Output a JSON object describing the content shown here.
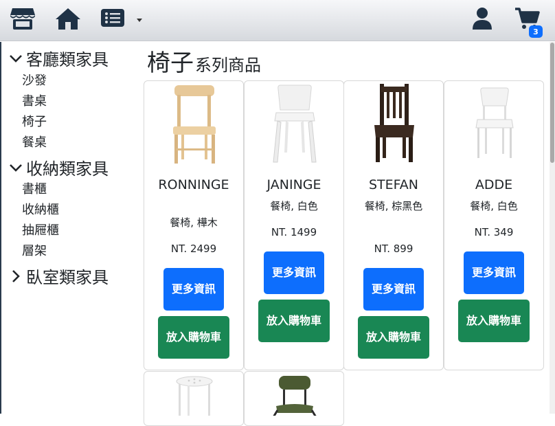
{
  "topbar": {
    "icons": [
      "store-icon",
      "home-icon",
      "list-icon",
      "user-icon",
      "cart-icon"
    ],
    "cart_count": "3",
    "bg_gradient": [
      "#f6f7f9",
      "#d6d9de"
    ]
  },
  "sidebar": {
    "categories": [
      {
        "label": "客廳類家具",
        "expanded": true,
        "items": [
          "沙發",
          "書桌",
          "椅子",
          "餐桌"
        ]
      },
      {
        "label": "收納類家具",
        "expanded": true,
        "items": [
          "書櫃",
          "收納櫃",
          "抽屜櫃",
          "層架"
        ]
      },
      {
        "label": "臥室類家具",
        "expanded": false,
        "items": []
      }
    ]
  },
  "main": {
    "title_big": "椅子",
    "title_small": "系列商品",
    "more_label": "更多資訊",
    "cart_label": "放入購物車",
    "products": [
      {
        "name": "RONNINGE",
        "desc": "餐椅, 樺木",
        "price": "NT. 2499"
      },
      {
        "name": "JANINGE",
        "desc": "餐椅, 白色",
        "price": "NT. 1499"
      },
      {
        "name": "STEFAN",
        "desc": "餐椅, 棕黑色",
        "price": "NT. 899"
      },
      {
        "name": "ADDE",
        "desc": "餐椅, 白色",
        "price": "NT. 349"
      }
    ]
  },
  "colors": {
    "primary": "#0d6efd",
    "success": "#198754",
    "text": "#212529",
    "icon": "#1f3246"
  }
}
